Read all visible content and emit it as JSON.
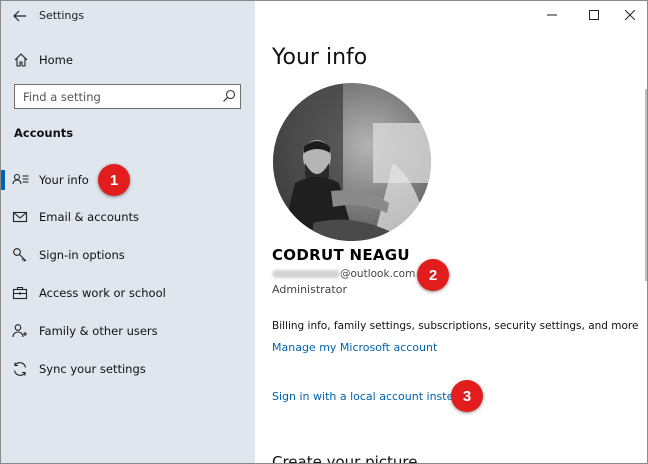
{
  "window": {
    "app_title": "Settings"
  },
  "sidebar": {
    "home_label": "Home",
    "search_placeholder": "Find a setting",
    "section_title": "Accounts",
    "items": [
      {
        "label": "Your info",
        "icon": "person-card-icon",
        "selected": true
      },
      {
        "label": "Email & accounts",
        "icon": "envelope-icon",
        "selected": false
      },
      {
        "label": "Sign-in options",
        "icon": "key-icon",
        "selected": false
      },
      {
        "label": "Access work or school",
        "icon": "briefcase-icon",
        "selected": false
      },
      {
        "label": "Family & other users",
        "icon": "person-plus-icon",
        "selected": false
      },
      {
        "label": "Sync your settings",
        "icon": "sync-icon",
        "selected": false
      }
    ]
  },
  "main": {
    "title": "Your info",
    "user_name": "CODRUT NEAGU",
    "email_domain": "@outlook.com",
    "role": "Administrator",
    "billing_text": "Billing info, family settings, subscriptions, security settings, and more",
    "manage_link": "Manage my Microsoft account",
    "local_account_link": "Sign in with a local account instead",
    "create_picture_title": "Create your picture"
  },
  "annotations": {
    "badge_1": "1",
    "badge_2": "2",
    "badge_3": "3",
    "badge_color": "#e11d1d"
  },
  "colors": {
    "accent": "#0063b1",
    "sidebar_bg": "#dfe6ee"
  }
}
